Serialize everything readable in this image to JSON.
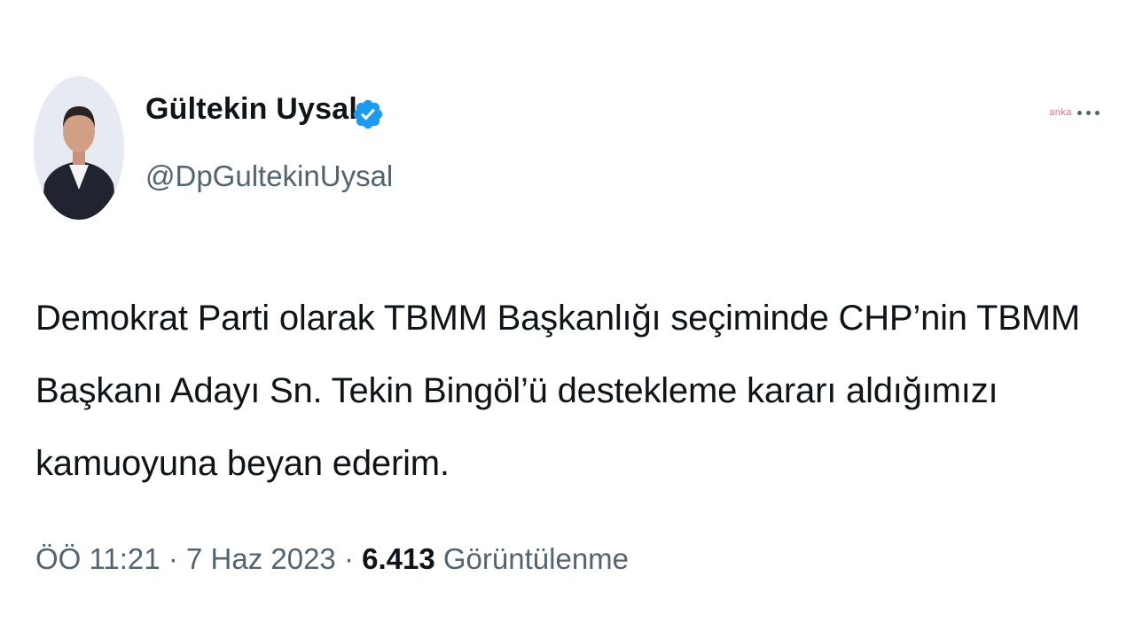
{
  "author": {
    "name": "Gültekin Uysal",
    "handle": "@DpGultekinUysal",
    "verified": true,
    "avatar": "profile-photo"
  },
  "header": {
    "watermark": "anka",
    "more_icon": "more-horizontal-icon"
  },
  "tweet": {
    "lines": [
      "Demokrat Parti olarak TBMM Başkanlığı seçiminde CHP’nin  TBMM",
      "Başkanı Adayı Sn. Tekin Bingöl’ü destekleme kararı aldığımızı",
      "kamuoyuna beyan ederim."
    ]
  },
  "meta": {
    "time": "ÖÖ 11:21",
    "separator": "·",
    "date": "7 Haz 2023",
    "views_count": "6.413",
    "views_label": "Görüntülenme"
  },
  "colors": {
    "text_primary": "#0f1419",
    "text_secondary": "#536471",
    "verified_blue": "#1d9bf0",
    "background": "#ffffff"
  }
}
